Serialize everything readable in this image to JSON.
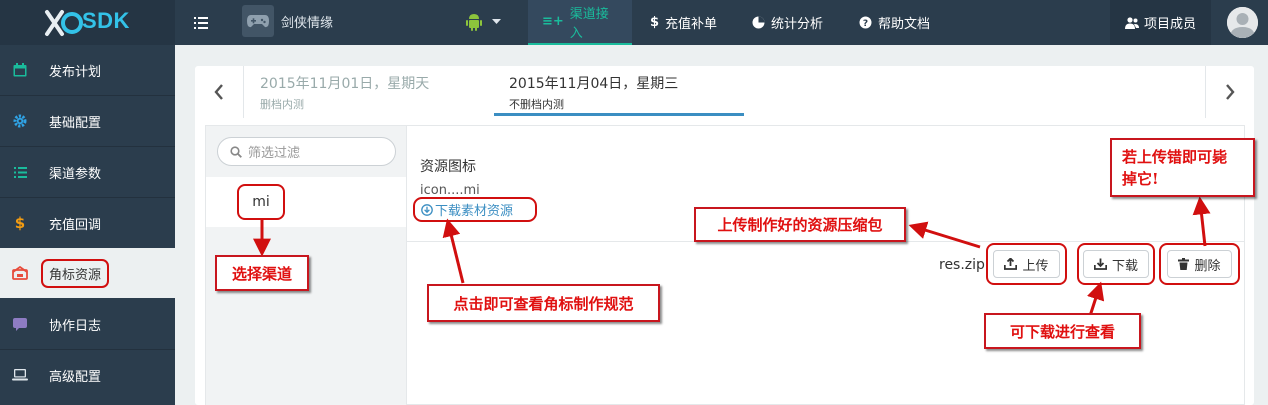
{
  "header": {
    "logo_text": "SDK",
    "game_name": "剑侠情缘",
    "nav": [
      {
        "label": "渠道接入",
        "icon": "channel-access-icon",
        "active": true
      },
      {
        "label": "充值补单",
        "icon": "dollar-icon",
        "active": false
      },
      {
        "label": "统计分析",
        "icon": "pie-chart-icon",
        "active": false
      },
      {
        "label": "帮助文档",
        "icon": "help-icon",
        "active": false
      }
    ],
    "members_label": "项目成员"
  },
  "sidebar": {
    "items": [
      {
        "label": "发布计划",
        "icon": "calendar-icon"
      },
      {
        "label": "基础配置",
        "icon": "gear-icon"
      },
      {
        "label": "渠道参数",
        "icon": "list-icon"
      },
      {
        "label": "充值回调",
        "icon": "dollar-icon"
      },
      {
        "label": "角标资源",
        "icon": "badge-icon"
      },
      {
        "label": "协作日志",
        "icon": "chat-icon"
      },
      {
        "label": "高级配置",
        "icon": "laptop-icon"
      }
    ]
  },
  "tabs": [
    {
      "date": "2015年11月01日，星期天",
      "sub": "删档内测"
    },
    {
      "date": "2015年11月04日，星期三",
      "sub": "不删档内测"
    }
  ],
  "filter": {
    "placeholder": "筛选过滤"
  },
  "channel": {
    "label": "mi"
  },
  "resource": {
    "title": "资源图标",
    "file": "icon....mi",
    "download_link": "下载素材资源",
    "zip_name": "res.zip",
    "upload_label": "上传",
    "download_label": "下载",
    "delete_label": "删除"
  },
  "annotations": {
    "select_channel": "选择渠道",
    "view_spec": "点击即可查看角标制作规范",
    "upload_pkg": "上传制作好的资源压缩包",
    "can_download": "可下载进行查看",
    "delete_tip_1": "若上传错即可毙",
    "delete_tip_2": "掉它!"
  },
  "colors": {
    "topbar": "#2b3d4d",
    "accent": "#1abc9c",
    "link": "#3b8ec2",
    "annotation_red": "#d10f0f"
  }
}
